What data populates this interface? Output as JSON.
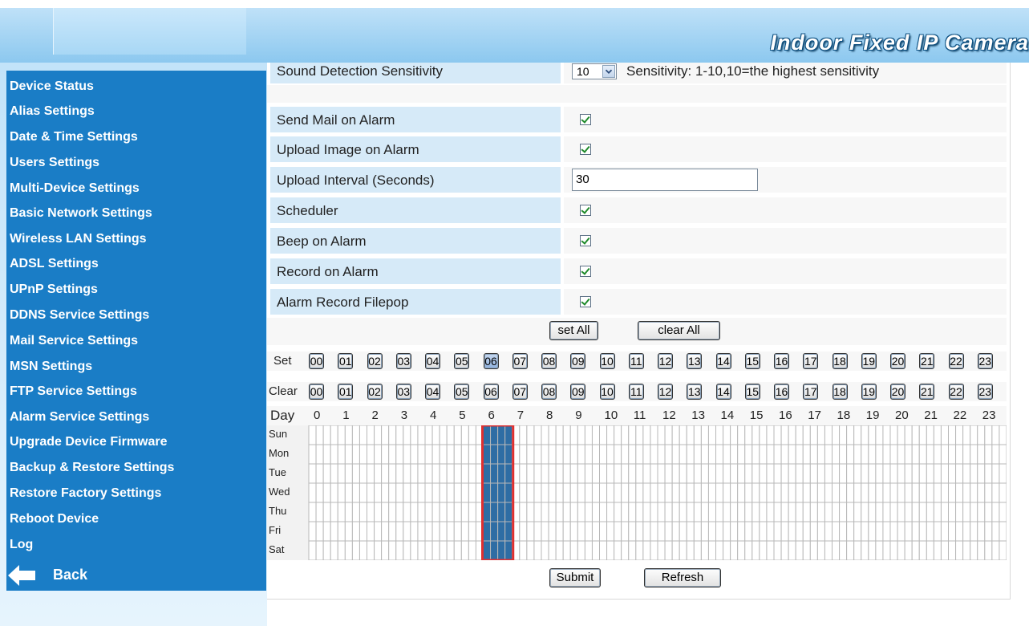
{
  "header": {
    "title": "Indoor Fixed IP Camera"
  },
  "sidebar": {
    "items": [
      {
        "label": "Device Status"
      },
      {
        "label": "Alias Settings"
      },
      {
        "label": "Date & Time Settings"
      },
      {
        "label": "Users Settings"
      },
      {
        "label": "Multi-Device Settings"
      },
      {
        "label": "Basic Network Settings"
      },
      {
        "label": "Wireless LAN Settings"
      },
      {
        "label": "ADSL Settings"
      },
      {
        "label": "UPnP Settings"
      },
      {
        "label": "DDNS Service Settings"
      },
      {
        "label": "Mail Service Settings"
      },
      {
        "label": "MSN Settings"
      },
      {
        "label": "FTP Service Settings"
      },
      {
        "label": "Alarm Service Settings"
      },
      {
        "label": "Upgrade Device Firmware"
      },
      {
        "label": "Backup & Restore Settings"
      },
      {
        "label": "Restore Factory Settings"
      },
      {
        "label": "Reboot Device"
      },
      {
        "label": "Log"
      }
    ],
    "back_label": "Back",
    "back_icon": "back-arrow-icon"
  },
  "form": {
    "sound_label": "Sound Detection Sensitivity",
    "sound_value": "10",
    "sound_note": "Sensitivity: 1-10,10=the highest sensitivity",
    "send_mail_label": "Send Mail on Alarm",
    "upload_image_label": "Upload Image on Alarm",
    "upload_interval_label": "Upload Interval (Seconds)",
    "upload_interval_value": "30",
    "scheduler_label": "Scheduler",
    "beep_label": "Beep on Alarm",
    "record_label": "Record on Alarm",
    "filepop_label": "Alarm Record Filepop"
  },
  "schedule": {
    "set_all_label": "set All",
    "clear_all_label": "clear All",
    "set_row_label": "Set",
    "clear_row_label": "Clear",
    "day_row_label": "Day",
    "hour_buttons": [
      "00",
      "01",
      "02",
      "03",
      "04",
      "05",
      "06",
      "07",
      "08",
      "09",
      "10",
      "11",
      "12",
      "13",
      "14",
      "15",
      "16",
      "17",
      "18",
      "19",
      "20",
      "21",
      "22",
      "23"
    ],
    "hour_labels": [
      "0",
      "1",
      "2",
      "3",
      "4",
      "5",
      "6",
      "7",
      "8",
      "9",
      "10",
      "11",
      "12",
      "13",
      "14",
      "15",
      "16",
      "17",
      "18",
      "19",
      "20",
      "21",
      "22",
      "23"
    ],
    "days": [
      "Sun",
      "Mon",
      "Tue",
      "Wed",
      "Thu",
      "Fri",
      "Sat"
    ],
    "selected_hour": 6,
    "colors": {
      "selected": "#2e6da4",
      "highlight": "#e03030",
      "empty": "#ffffff"
    }
  },
  "footer": {
    "submit_label": "Submit",
    "refresh_label": "Refresh"
  }
}
